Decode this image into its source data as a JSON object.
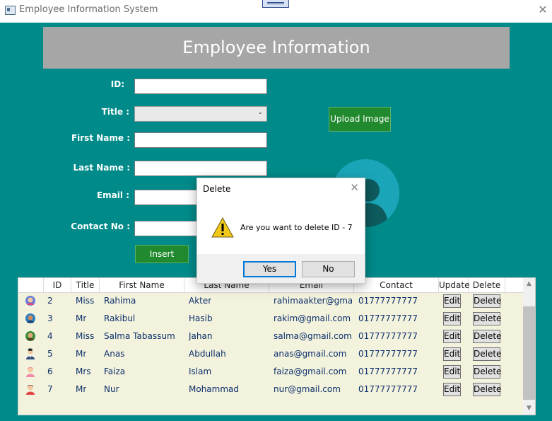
{
  "window": {
    "title": "Employee Information System"
  },
  "header": {
    "title": "Employee Information"
  },
  "form": {
    "id_label": "ID:",
    "title_label": "Title :",
    "first_name_label": "First Name :",
    "last_name_label": "Last Name :",
    "email_label": "Email :",
    "contact_label": "Contact No :",
    "insert_button": "Insert",
    "upload_button": "Upload Image"
  },
  "table": {
    "columns": [
      "ID",
      "Title",
      "First Name",
      "Last Name",
      "Email",
      "Contact",
      "Update",
      "Delete"
    ],
    "edit_label": "Edit",
    "delete_label": "Delete",
    "rows": [
      {
        "id": "2",
        "title": "Miss",
        "first": "Rahima",
        "last": "Akter",
        "email": "rahimaakter@gmail.c",
        "contact": "01777777777"
      },
      {
        "id": "3",
        "title": "Mr",
        "first": "Rakibul",
        "last": "Hasib",
        "email": "rakim@gmail.com",
        "contact": "01777777777"
      },
      {
        "id": "4",
        "title": "Miss",
        "first": "Salma Tabassum",
        "last": "Jahan",
        "email": "salma@gmail.com",
        "contact": "01777777777"
      },
      {
        "id": "5",
        "title": "Mr",
        "first": "Anas",
        "last": "Abdullah",
        "email": "anas@gmail.com",
        "contact": "01777777777"
      },
      {
        "id": "6",
        "title": "Mrs",
        "first": "Faiza",
        "last": "Islam",
        "email": "faiza@gmail.com",
        "contact": "01777777777"
      },
      {
        "id": "7",
        "title": "Mr",
        "first": "Nur",
        "last": "Mohammad",
        "email": "nur@gmail.com",
        "contact": "01777777777"
      }
    ]
  },
  "dialog": {
    "title": "Delete",
    "message": "Are you want to delete ID - 7",
    "yes_label": "Yes",
    "no_label": "No"
  },
  "colors": {
    "background": "#008a8a",
    "header": "#a6a6a6",
    "button_green": "#218a2e",
    "grid_background": "#f2f2dd"
  },
  "icons": {
    "dialog": "warning-icon",
    "close": "close-icon",
    "window": "app-icon"
  }
}
